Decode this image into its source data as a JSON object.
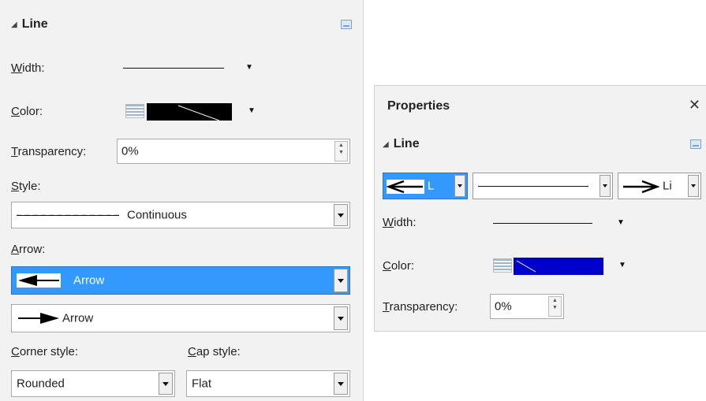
{
  "left_panel": {
    "section_title": "Line",
    "width_label": "Width:",
    "color_label": "Color:",
    "color_value": "#000000",
    "transparency_label": "Transparency:",
    "transparency_value": "0%",
    "style_label": "Style:",
    "style_value": "Continuous",
    "arrow_label": "Arrow:",
    "arrow_start": "Arrow",
    "arrow_end": "Arrow",
    "corner_style_label": "Corner style:",
    "corner_style_value": "Rounded",
    "cap_style_label": "Cap style:",
    "cap_style_value": "Flat"
  },
  "properties_panel": {
    "title": "Properties",
    "section_title": "Line",
    "arrow_start_partial": "L",
    "arrow_end_partial": "Li",
    "width_label": "Width:",
    "color_label": "Color:",
    "color_value": "#0000cc",
    "transparency_label": "Transparency:",
    "transparency_value": "0%"
  },
  "icons": {
    "collapse": "triangle-down",
    "more_options": "more-options-icon",
    "close": "close-icon",
    "dropdown": "chevron-down-icon"
  },
  "colors": {
    "selection": "#3399ff",
    "panel_bg": "#f2f2f2"
  }
}
